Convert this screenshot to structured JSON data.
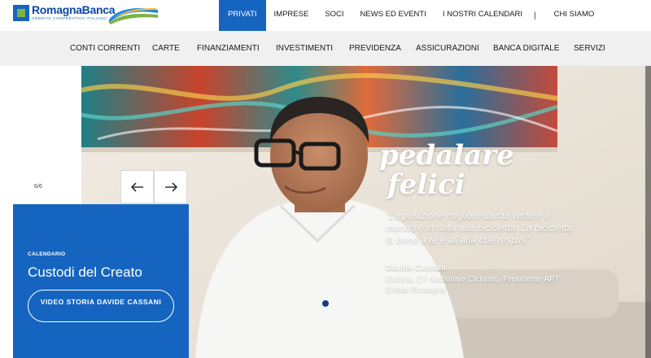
{
  "brand": {
    "name": "RomagnaBanca",
    "tagline": "CREDITO COOPERATIVO ITALIANO"
  },
  "top_nav": {
    "items": [
      "PRIVATI",
      "IMPRESE",
      "SOCI",
      "NEWS ED EVENTI",
      "I NOSTRI CALENDARI",
      "CHI SIAMO"
    ],
    "separator": "|",
    "active": "PRIVATI"
  },
  "sub_nav": {
    "items": [
      "CONTI CORRENTI",
      "CARTE",
      "FINANZIAMENTI",
      "INVESTIMENTI",
      "PREVIDENZA",
      "ASSICURAZIONI",
      "BANCA DIGITALE",
      "SERVIZI"
    ]
  },
  "slider": {
    "counter": "6/6",
    "prev_icon": "arrow-left-icon",
    "next_icon": "arrow-right-icon"
  },
  "card": {
    "category": "CALENDARIO",
    "title": "Custodi del Creato",
    "button_label": "VIDEO STORIA DAVIDE CASSANI"
  },
  "hero": {
    "headline_line1": "pedalare",
    "headline_line2": "felici",
    "quote": "“La posizione migliore da cui vedere il mondo è in sella alla bicicletta. La bicicletta fa bene a te e all’aria che respiri.”",
    "author": "Davide Cassani",
    "role": "Ciclista, CT Nazionale Ciclismo, Presidente APT Emilia Romagna"
  },
  "colors": {
    "brand_blue": "#1565c0",
    "brand_green": "#7cb342",
    "subnav_bg": "#f0f0f0"
  }
}
